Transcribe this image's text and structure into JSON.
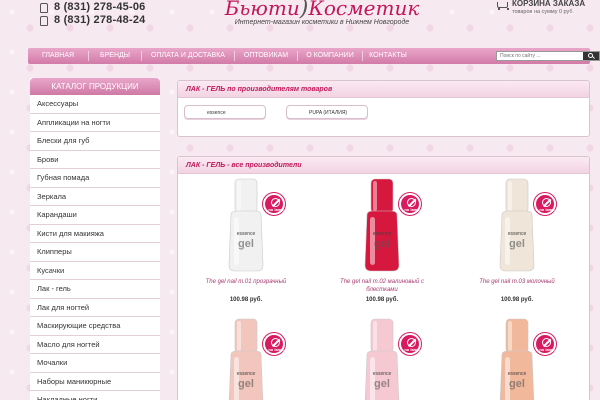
{
  "header": {
    "phones": [
      "8 (831) 278-45-06",
      "8 (831) 278-48-24"
    ],
    "logo_title_left": "Бьюти",
    "logo_title_right": "Косметик",
    "logo_subtitle": "Интернет-магазин косметики в Нижнем Новгороде",
    "cart_title": "КОРЗИНА ЗАКАЗА",
    "cart_info": "товаров на сумму 0 руб."
  },
  "nav": {
    "items": [
      "ГЛАВНАЯ",
      "БРЕНДЫ",
      "ОПЛАТА И ДОСТАВКА",
      "ОПТОВИКАМ",
      "О КОМПАНИИ",
      "КОНТАКТЫ"
    ],
    "search_placeholder": "Поиск по сайту ..."
  },
  "sidebar": {
    "title": "КАТАЛОГ ПРОДУКЦИИ",
    "items": [
      "Аксессуары",
      "Аппликации на ногти",
      "Блески для губ",
      "Брови",
      "Губная помада",
      "Зеркала",
      "Карандаши",
      "Кисти для макияжа",
      "Клипперы",
      "Кусачки",
      "Лак - гель",
      "Лак для ногтей",
      "Маскирующие средства",
      "Масло для ногтей",
      "Мочалки",
      "Наборы маникюрные",
      "Накладные ногти"
    ]
  },
  "manufacturers": {
    "title": "ЛАК - ГЕЛЬ по производителям товаров",
    "items": [
      "essence",
      "PUPA (ИТАЛИЯ)"
    ]
  },
  "products": {
    "title": "ЛАК - ГЕЛЬ - все производители",
    "badge": "no lamp",
    "items": [
      {
        "name": "The gel nail т.01 прозрачный",
        "price": "100.98 руб.",
        "color": "#f1f1f1"
      },
      {
        "name": "The gel nail т.02 малиновый с блестками",
        "price": "100.98 руб.",
        "color": "#d7183e"
      },
      {
        "name": "The gel nail т.03 молочный",
        "price": "100.98 руб.",
        "color": "#efe5d8"
      },
      {
        "name": "",
        "price": "",
        "color": "#f2c6bc"
      },
      {
        "name": "",
        "price": "",
        "color": "#f6c9d2"
      },
      {
        "name": "",
        "price": "",
        "color": "#f2b89b"
      }
    ]
  },
  "bottle_text": "essence the gel",
  "colors": {
    "accent": "#c2185b",
    "nav": "#d27aa8",
    "badge": "#d81b60"
  }
}
